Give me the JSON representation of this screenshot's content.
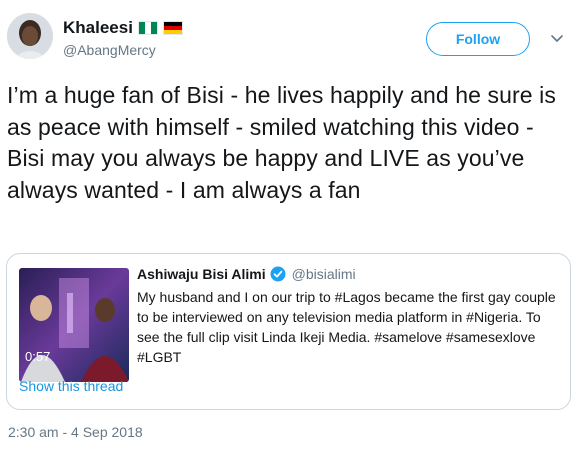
{
  "author": {
    "display_name": "Khaleesi",
    "handle": "@AbangMercy",
    "flags": [
      "nigeria-flag-icon",
      "germany-flag-icon"
    ]
  },
  "follow_button": {
    "label": "Follow"
  },
  "tweet": {
    "text": "I’m a huge fan of Bisi - he lives happily and he sure is as peace with himself - smiled watching this video - Bisi may you always be happy and LIVE as you’ve always wanted - I am always a fan",
    "timestamp": "2:30 am - 4 Sep 2018"
  },
  "quoted_tweet": {
    "display_name": "Ashiwaju Bisi Alimi",
    "handle": "@bisialimi",
    "verified": true,
    "text": "My husband and I on our trip to #Lagos became the first gay couple to be interviewed on any television media platform in #Nigeria. To see the full clip visit Linda Ikeji Media. #samelove #samesexlove #LGBT",
    "video_duration": "0:57",
    "show_thread_label": "Show this thread"
  },
  "colors": {
    "accent": "#1da1f2",
    "link": "#1b95e0",
    "secondary_text": "#657786",
    "border": "#ccd6dd"
  }
}
